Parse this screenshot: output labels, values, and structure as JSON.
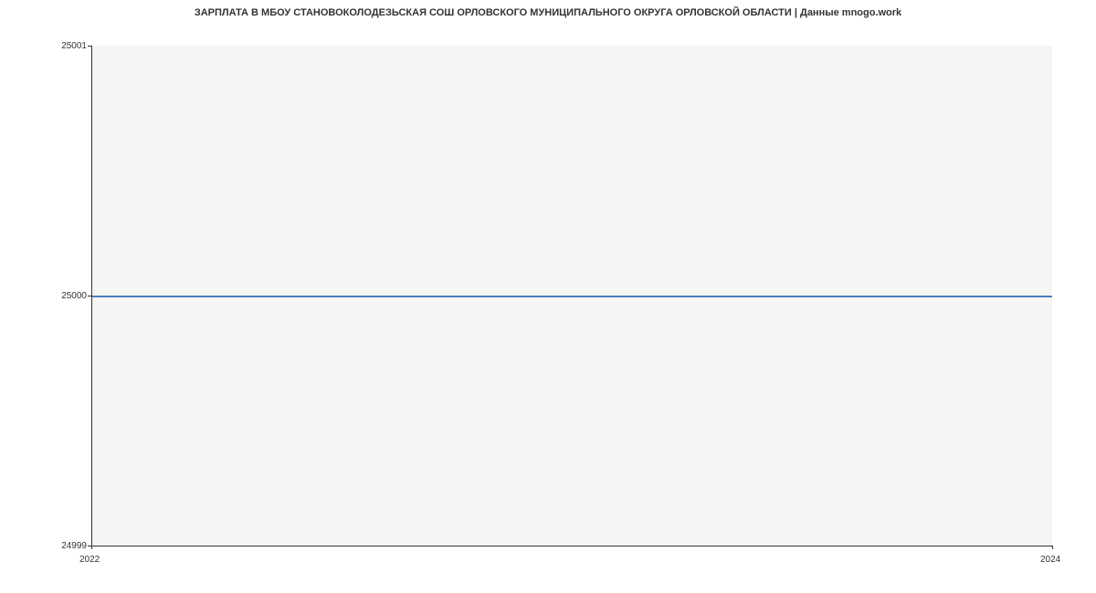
{
  "chart_data": {
    "type": "line",
    "title": "ЗАРПЛАТА В МБОУ  СТАНОВОКОЛОДЕЗЬСКАЯ СОШ ОРЛОВСКОГО МУНИЦИПАЛЬНОГО ОКРУГА ОРЛОВСКОЙ ОБЛАСТИ | Данные mnogo.work",
    "x": [
      2022,
      2024
    ],
    "values": [
      25000,
      25000
    ],
    "xlabel": "",
    "ylabel": "",
    "xlim": [
      2022,
      2024
    ],
    "ylim": [
      24999,
      25001
    ],
    "x_ticks": [
      2022,
      2024
    ],
    "y_ticks": [
      24999,
      25000,
      25001
    ],
    "line_color": "#4a7ebb",
    "plot_bg": "#f5f5f3"
  },
  "title": "ЗАРПЛАТА В МБОУ  СТАНОВОКОЛОДЕЗЬСКАЯ СОШ ОРЛОВСКОГО МУНИЦИПАЛЬНОГО ОКРУГА ОРЛОВСКОЙ ОБЛАСТИ | Данные mnogo.work",
  "y_labels": {
    "top": "25001",
    "mid": "25000",
    "bot": "24999"
  },
  "x_labels": {
    "left": "2022",
    "right": "2024"
  }
}
